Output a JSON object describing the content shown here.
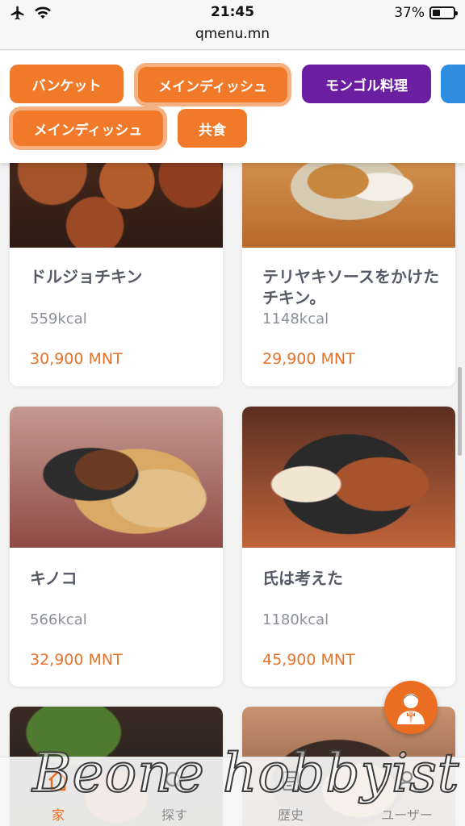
{
  "status_bar": {
    "time": "21:45",
    "battery": "37%",
    "battery_fraction": 0.37,
    "url": "qmenu.mn",
    "icons": [
      "airplane-icon",
      "wifi-icon",
      "battery-icon"
    ]
  },
  "categories": {
    "row1": [
      "バンケット",
      "メインディッシュ",
      "モンゴル料理"
    ],
    "row2": [
      "メインディッシュ",
      "共食"
    ],
    "selected": "メインディッシュ",
    "colors": {
      "orange": "#f07a2a",
      "purple": "#6b1fa0",
      "blue": "#2e8ee0",
      "selected_ring": "#f6b183"
    }
  },
  "menu_items": [
    {
      "name": "ドルジョチキン",
      "kcal": "559kcal",
      "price": "30,900 MNT"
    },
    {
      "name": "テリヤキソースをかけたチキン。",
      "kcal": "1148kcal",
      "price": "29,900 MNT"
    },
    {
      "name": "キノコ",
      "kcal": "566kcal",
      "price": "32,900 MNT"
    },
    {
      "name": "氏は考えた",
      "kcal": "1180kcal",
      "price": "45,900 MNT"
    }
  ],
  "fab": {
    "icon": "waiter-icon"
  },
  "bottom_nav": {
    "items": [
      {
        "label": "家",
        "icon": "home-icon",
        "active": true
      },
      {
        "label": "探す",
        "icon": "search-icon",
        "active": false
      },
      {
        "label": "歴史",
        "icon": "history-icon",
        "active": false
      },
      {
        "label": "ユーザー",
        "icon": "user-icon",
        "active": false
      }
    ]
  },
  "watermark": "Beone hobbyist",
  "accent_color": "#ea6d22"
}
